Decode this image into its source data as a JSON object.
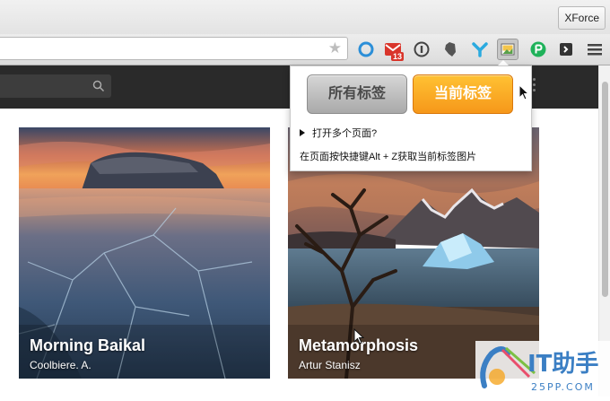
{
  "window": {
    "profile_button": "XForce"
  },
  "toolbar": {
    "icons": [
      "circle-icon",
      "gmail-icon",
      "info-icon",
      "evernote-icon",
      "y-icon",
      "screenshot-icon",
      "p-icon",
      "pocket-icon",
      "menu-icon"
    ],
    "gmail_badge": "13"
  },
  "popup": {
    "btn_all": "所有标签",
    "btn_current": "当前标签",
    "question": "打开多个页面?",
    "hint": "在页面按快捷键Alt + Z获取当前标签图片"
  },
  "cards": [
    {
      "title": "Morning Baikal",
      "author": "Coolbiere. A."
    },
    {
      "title": "Metamorphosis",
      "author": "Artur Stanisz"
    }
  ],
  "watermark": {
    "text": "IT助手",
    "sub": "25PP.COM"
  },
  "colors": {
    "accent_orange": "#f6981a",
    "header_dark": "#2a2a2a"
  }
}
